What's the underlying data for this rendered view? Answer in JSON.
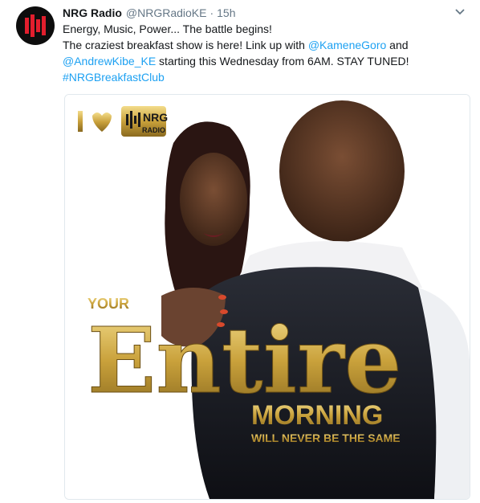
{
  "tweet": {
    "display_name": "NRG Radio",
    "handle": "@NRGRadioKE",
    "separator": "·",
    "timestamp": "15h",
    "line1": "Energy, Music, Power... The battle begins!",
    "line2_prefix": "The craziest breakfast show is here! Link up with ",
    "mention1": "@KameneGoro",
    "line2_suffix": " and",
    "mention2": "@AndrewKibe_KE",
    "line3_suffix": " starting this Wednesday from 6AM. STAY TUNED!",
    "hashtag": "#NRGBreakfastClub"
  },
  "media": {
    "logo_text": "NRG",
    "logo_sub": "RADIO",
    "headline_small": "YOUR",
    "headline_big": "Entire",
    "headline_mid": "MORNING",
    "headline_tag": "WILL NEVER BE THE SAME"
  },
  "colors": {
    "link": "#1da1f2",
    "secondary_text": "#657786",
    "gold": "#c9a13b",
    "logo_red": "#e21e2d"
  },
  "icons": {
    "caret": "chevron-down-icon",
    "avatar": "nrg-logo-avatar"
  }
}
